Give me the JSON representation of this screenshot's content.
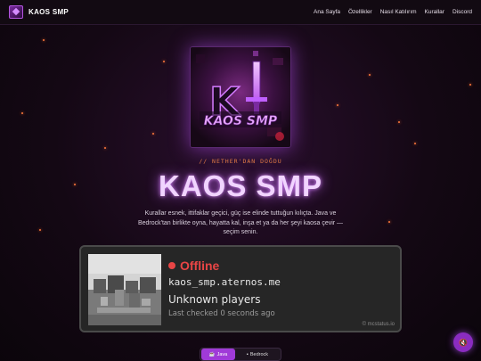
{
  "nav": {
    "brand": "KAOS SMP",
    "links": [
      "Ana Sayfa",
      "Özellikler",
      "Nasıl Katılırım",
      "Kurallar",
      "Discord"
    ]
  },
  "hero": {
    "logo_text": "KAOS SMP",
    "logo_letter": "K",
    "subtitle": "// NETHER'DAN DOĞDU",
    "title": "KAOS SMP",
    "description": "Kurallar esnek, ittifaklar geçici, güç ise elinde tuttuğun kılıçta. Java ve Bedrock'tan birlikte oyna, hayatta kal, inşa et ya da her şeyi kaosa çevir — seçim senin."
  },
  "status": {
    "state": "Offline",
    "address": "kaos_smp.aternos.me",
    "players": "Unknown players",
    "last_checked": "Last checked 0 seconds ago",
    "credit": "© mcstatus.io",
    "status_color": "#e84545"
  },
  "editions": {
    "java_label": "Java",
    "bedrock_label": "Bedrock",
    "java_icon": "coffee-icon",
    "bedrock_icon": "block-icon"
  },
  "music": {
    "icon": "speaker-muted-icon"
  },
  "colors": {
    "accent": "#a03ad8",
    "ember": "#ff7a3d",
    "title_glow": "#f1d4ff"
  }
}
